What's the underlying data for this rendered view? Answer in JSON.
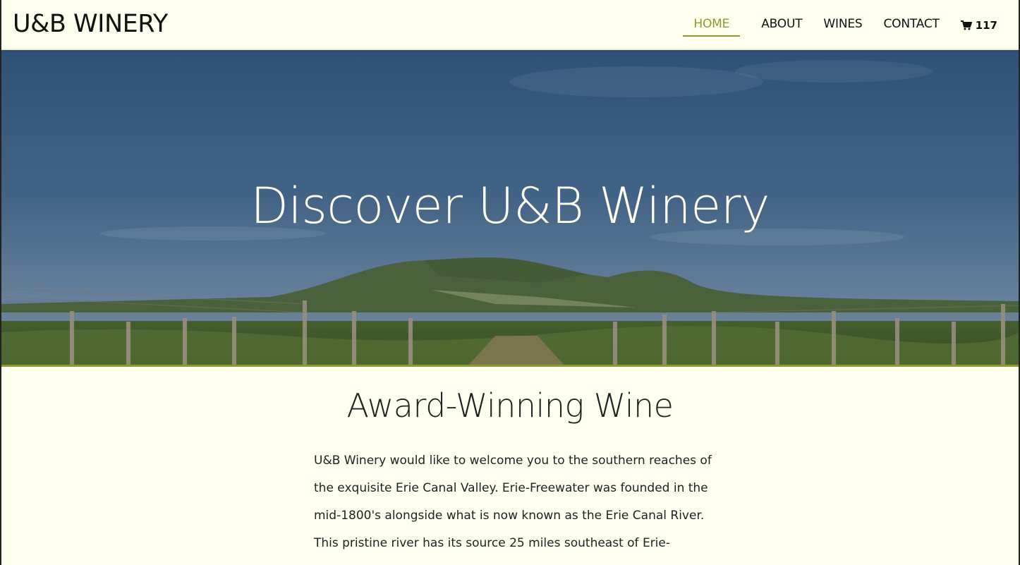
{
  "header": {
    "logo": "U&B WINERY",
    "nav": [
      {
        "label": "HOME",
        "active": true
      },
      {
        "label": "ABOUT",
        "active": false
      },
      {
        "label": "WINES",
        "active": false
      },
      {
        "label": "CONTACT",
        "active": false
      }
    ],
    "cart": {
      "icon": "cart-icon",
      "count": "117"
    }
  },
  "hero": {
    "title": "Discover U&B Winery"
  },
  "main": {
    "section_title": "Award-Winning Wine",
    "body": "U&B Winery would like to welcome you to the southern reaches of the exquisite Erie Canal Valley. Erie-Freewater was founded in the mid-1800's alongside what is now known as the Erie Canal River. This pristine river has its source 25 miles southeast of Erie-Freewater in the Wallowa Mountains. From the"
  },
  "colors": {
    "background": "#fffff0",
    "accent": "#8a9b2c",
    "text": "#222222"
  }
}
